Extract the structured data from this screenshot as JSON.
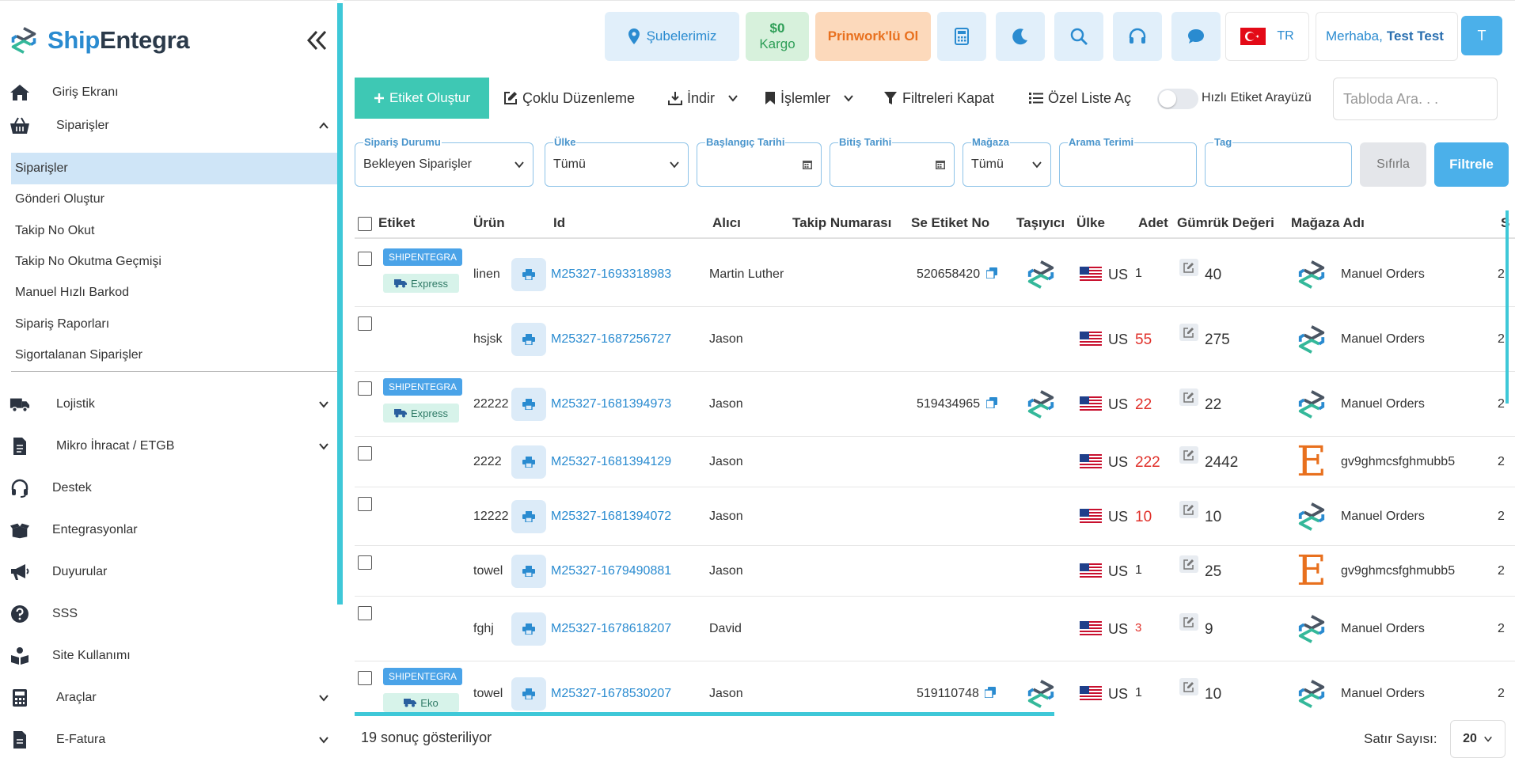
{
  "brand": {
    "part1": "Ship",
    "part2": "Entegra"
  },
  "sidebar": {
    "items": [
      {
        "label": "Giriş Ekranı",
        "icon": "home-icon"
      },
      {
        "label": "Siparişler",
        "icon": "basket-icon",
        "expanded": true
      },
      {
        "label": "Lojistik",
        "icon": "truck-icon"
      },
      {
        "label": "Mikro İhracat / ETGB",
        "icon": "document-icon"
      },
      {
        "label": "Destek",
        "icon": "headset-icon"
      },
      {
        "label": "Entegrasyonlar",
        "icon": "box-open-icon"
      },
      {
        "label": "Duyurular",
        "icon": "megaphone-icon"
      },
      {
        "label": "SSS",
        "icon": "question-icon"
      },
      {
        "label": "Site Kullanımı",
        "icon": "book-reader-icon"
      },
      {
        "label": "Araçlar",
        "icon": "calculator-icon"
      },
      {
        "label": "E-Fatura",
        "icon": "invoice-icon"
      }
    ],
    "subitems": [
      {
        "label": "Siparişler",
        "active": true
      },
      {
        "label": "Gönderi Oluştur"
      },
      {
        "label": "Takip No Okut"
      },
      {
        "label": "Takip No Okutma Geçmişi"
      },
      {
        "label": "Manuel Hızlı Barkod"
      },
      {
        "label": "Sipariş Raporları"
      },
      {
        "label": "Sigortalanan Siparişler"
      }
    ]
  },
  "topbar": {
    "branches": "Şubelerimiz",
    "balance_amount": "$0",
    "balance_label": "Kargo",
    "prinwork": "Prinwork'lü Ol",
    "language": "TR",
    "greeting": "Merhaba,",
    "user_name": "Test Test",
    "avatar_initial": "T"
  },
  "toolbar": {
    "create": "Etiket Oluştur",
    "bulk_edit": "Çoklu Düzenleme",
    "download": "İndir",
    "actions": "İşlemler",
    "close_filters": "Filtreleri Kapat",
    "custom_list": "Özel Liste Aç",
    "quick_label": "Hızlı Etiket Arayüzü",
    "table_search_placeholder": "Tabloda Ara. . ."
  },
  "filters": {
    "status_label": "Sipariş Durumu",
    "status_value": "Bekleyen Siparişler",
    "country_label": "Ülke",
    "country_value": "Tümü",
    "start_label": "Başlangıç Tarihi",
    "end_label": "Bitiş Tarihi",
    "store_label": "Mağaza",
    "store_value": "Tümü",
    "term_label": "Arama Terimi",
    "tag_label": "Tag",
    "reset": "Sıfırla",
    "apply": "Filtrele"
  },
  "table": {
    "headers": [
      "Etiket",
      "Ürün",
      "Id",
      "Alıcı",
      "Takip Numarası",
      "Se Etiket No",
      "Taşıyıcı",
      "Ülke",
      "Adet",
      "Gümrük Değeri",
      "Mağaza Adı",
      "S"
    ],
    "rows": [
      {
        "badge": "SHIPENTEGRA",
        "service": "Express",
        "product": "linen",
        "id": "M25327-1693318983",
        "recipient": "Martin Luther",
        "tracking": "",
        "se_label": "520658420",
        "carrier": "shipentegra",
        "country": "US",
        "qty": "1",
        "qty_highlight": false,
        "customs": "40",
        "store": "Manuel Orders",
        "store_type": "shipentegra",
        "extra": "2"
      },
      {
        "badge": "",
        "service": "",
        "product": "hsjsk",
        "id": "M25327-1687256727",
        "recipient": "Jason",
        "tracking": "",
        "se_label": "",
        "carrier": "",
        "country": "US",
        "qty": "55",
        "qty_highlight": true,
        "customs": "275",
        "store": "Manuel Orders",
        "store_type": "shipentegra",
        "extra": "2"
      },
      {
        "badge": "SHIPENTEGRA",
        "service": "Express",
        "product": "22222",
        "id": "M25327-1681394973",
        "recipient": "Jason",
        "tracking": "",
        "se_label": "519434965",
        "carrier": "shipentegra",
        "country": "US",
        "qty": "22",
        "qty_highlight": true,
        "customs": "22",
        "store": "Manuel Orders",
        "store_type": "shipentegra",
        "extra": "2"
      },
      {
        "badge": "",
        "service": "",
        "product": "2222",
        "id": "M25327-1681394129",
        "recipient": "Jason",
        "tracking": "",
        "se_label": "",
        "carrier": "",
        "country": "US",
        "qty": "222",
        "qty_highlight": true,
        "customs": "2442",
        "store": "gv9ghmcsfghmubb5",
        "store_type": "etsy",
        "extra": "2"
      },
      {
        "badge": "",
        "service": "",
        "product": "12222",
        "id": "M25327-1681394072",
        "recipient": "Jason",
        "tracking": "",
        "se_label": "",
        "carrier": "",
        "country": "US",
        "qty": "10",
        "qty_highlight": true,
        "customs": "10",
        "store": "Manuel Orders",
        "store_type": "shipentegra",
        "extra": "2"
      },
      {
        "badge": "",
        "service": "",
        "product": "towel",
        "id": "M25327-1679490881",
        "recipient": "Jason",
        "tracking": "",
        "se_label": "",
        "carrier": "",
        "country": "US",
        "qty": "1",
        "qty_highlight": false,
        "customs": "25",
        "store": "gv9ghmcsfghmubb5",
        "store_type": "etsy",
        "extra": "2"
      },
      {
        "badge": "",
        "service": "",
        "product": "fghj",
        "id": "M25327-1678618207",
        "recipient": "David",
        "tracking": "",
        "se_label": "",
        "carrier": "",
        "country": "US",
        "qty": "3",
        "qty_highlight": true,
        "customs": "9",
        "store": "Manuel Orders",
        "store_type": "shipentegra",
        "extra": "2"
      },
      {
        "badge": "SHIPENTEGRA",
        "service": "Eko",
        "product": "towel",
        "id": "M25327-1678530207",
        "recipient": "Jason",
        "tracking": "",
        "se_label": "519110748",
        "carrier": "shipentegra",
        "country": "US",
        "qty": "1",
        "qty_highlight": false,
        "customs": "10",
        "store": "Manuel Orders",
        "store_type": "shipentegra",
        "extra": "2"
      }
    ]
  },
  "footer": {
    "results": "19 sonuç gösteriliyor",
    "rows_label": "Satır Sayısı:",
    "rows_value": "20"
  },
  "colors": {
    "accent": "#2a8bd0",
    "teal": "#3ec8b4",
    "scroll": "#3ec8d8",
    "red": "#e0302a",
    "orange": "#e8701e"
  }
}
